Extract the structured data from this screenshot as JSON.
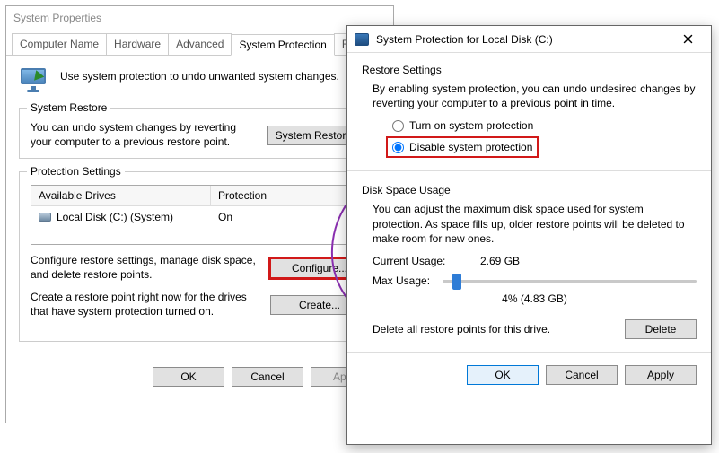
{
  "sp": {
    "title": "System Properties",
    "tabs": [
      "Computer Name",
      "Hardware",
      "Advanced",
      "System Protection",
      "Remote"
    ],
    "active_tab": 3,
    "intro": "Use system protection to undo unwanted system changes.",
    "restore": {
      "legend": "System Restore",
      "text": "You can undo system changes by reverting your computer to a previous restore point.",
      "button": "System Restore..."
    },
    "settings": {
      "legend": "Protection Settings",
      "col_drive": "Available Drives",
      "col_prot": "Protection",
      "drives": [
        {
          "name": "Local Disk (C:) (System)",
          "protection": "On"
        }
      ],
      "configure_text": "Configure restore settings, manage disk space, and delete restore points.",
      "configure_btn": "Configure...",
      "create_text": "Create a restore point right now for the drives that have system protection turned on.",
      "create_btn": "Create..."
    },
    "buttons": {
      "ok": "OK",
      "cancel": "Cancel",
      "apply": "Apply"
    }
  },
  "prot": {
    "title": "System Protection for Local Disk (C:)",
    "restore_settings": {
      "legend": "Restore Settings",
      "desc": "By enabling system protection, you can undo undesired changes by reverting your computer to a previous point in time.",
      "opt_on": "Turn on system protection",
      "opt_off": "Disable system protection",
      "selected": "off"
    },
    "usage": {
      "legend": "Disk Space Usage",
      "desc": "You can adjust the maximum disk space used for system protection. As space fills up, older restore points will be deleted to make room for new ones.",
      "current_label": "Current Usage:",
      "current_value": "2.69 GB",
      "max_label": "Max Usage:",
      "slider_pct": 4,
      "readout": "4% (4.83 GB)",
      "delete_text": "Delete all restore points for this drive.",
      "delete_btn": "Delete"
    },
    "buttons": {
      "ok": "OK",
      "cancel": "Cancel",
      "apply": "Apply"
    }
  }
}
